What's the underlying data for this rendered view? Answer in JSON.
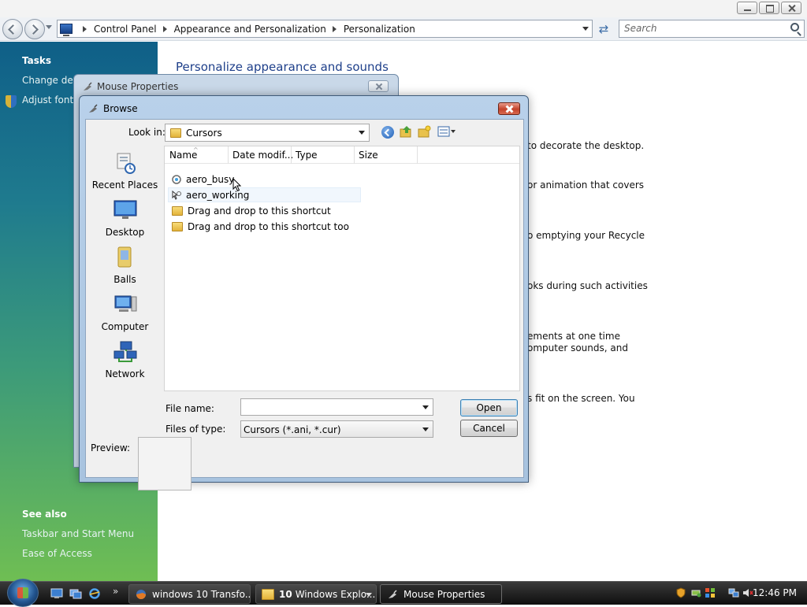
{
  "explorer": {
    "breadcrumb": [
      "Control Panel",
      "Appearance and Personalization",
      "Personalization"
    ],
    "search_placeholder": "Search"
  },
  "left_pane": {
    "tasks_heading": "Tasks",
    "tasks": [
      "Change desk",
      "Adjust font s"
    ],
    "see_also_heading": "See also",
    "see_also": [
      "Taskbar and Start Menu",
      "Ease of Access"
    ]
  },
  "content": {
    "title": "Personalize appearance and sounds",
    "fragments": [
      "to decorate the desktop.",
      "or animation that covers",
      "o emptying your Recycle",
      "oks during such activities",
      "ements at one time",
      "omputer sounds, and",
      "s fit on the screen. You"
    ]
  },
  "mouse_properties": {
    "title": "Mouse Properties"
  },
  "browse": {
    "title": "Browse",
    "look_in_label": "Look in:",
    "look_in_value": "Cursors",
    "places": [
      "Recent Places",
      "Desktop",
      "Balls",
      "Computer",
      "Network"
    ],
    "columns": [
      "Name",
      "Date modif...",
      "Type",
      "Size"
    ],
    "files": [
      {
        "name": "aero_busy",
        "icon": "busy-cursor-icon"
      },
      {
        "name": "aero_working",
        "icon": "working-cursor-icon"
      },
      {
        "name": "Drag and drop to this shortcut",
        "icon": "shortcut-folder-icon"
      },
      {
        "name": "Drag and drop to this shortcut too",
        "icon": "folder-icon"
      }
    ],
    "file_name_label": "File name:",
    "file_name_value": "",
    "files_of_type_label": "Files of type:",
    "files_of_type_value": "Cursors (*.ani, *.cur)",
    "open_label": "Open",
    "cancel_label": "Cancel",
    "preview_label": "Preview:"
  },
  "taskbar": {
    "tasks": [
      {
        "label": "windows 10 Transfo...",
        "icon": "firefox-icon"
      },
      {
        "count": "10",
        "label": "Windows Explo...",
        "icon": "folder-icon"
      },
      {
        "label": "Mouse Properties",
        "icon": "mouse-icon"
      }
    ],
    "more": "»",
    "clock": "12:46 PM"
  },
  "colors": {
    "title_blue": "#1e3f8a",
    "close_red": "#c4422b",
    "pane_top": "#0f5f88",
    "pane_bottom": "#6fbe53"
  }
}
